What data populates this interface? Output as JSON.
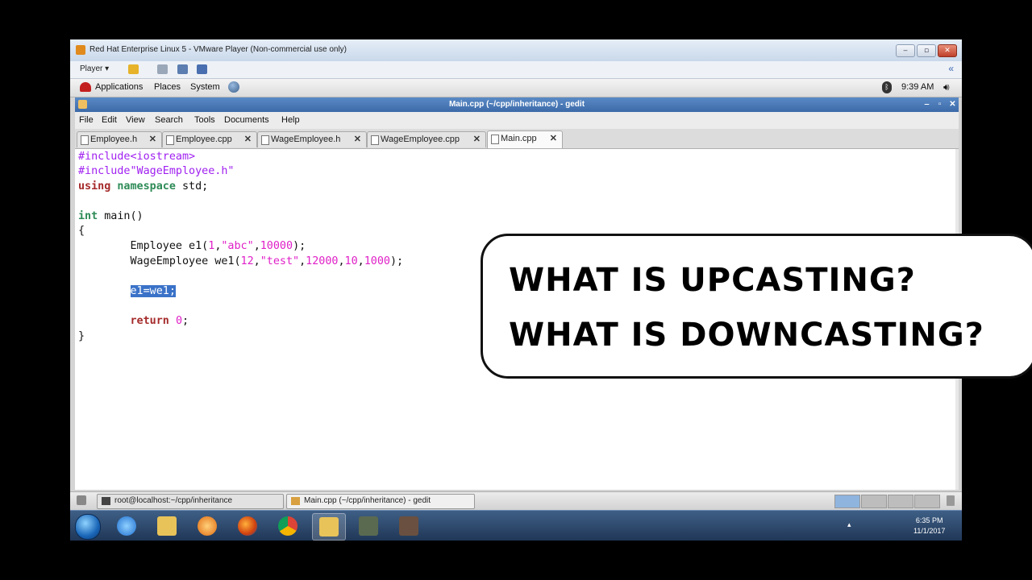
{
  "vmware": {
    "title": "Red Hat Enterprise Linux 5 - VMware Player (Non-commercial use only)",
    "player_menu": "Player ▾"
  },
  "gnome_panel": {
    "applications": "Applications",
    "places": "Places",
    "system": "System",
    "clock": "9:39 AM"
  },
  "gedit": {
    "title": "Main.cpp (~/cpp/inheritance) - gedit",
    "menu": [
      "File",
      "Edit",
      "View",
      "Search",
      "Tools",
      "Documents",
      "Help"
    ],
    "tabs": [
      "Employee.h",
      "Employee.cpp",
      "WageEmployee.h",
      "WageEmployee.cpp",
      "Main.cpp"
    ],
    "active_tab": "Main.cpp",
    "code": {
      "include1": "#include<iostream>",
      "include2": "#include\"WageEmployee.h\"",
      "using": "using",
      "namespace": "namespace",
      "std": " std;",
      "int": "int",
      "main": " main()",
      "open_brace": "{",
      "emp_decl": "        Employee e1(",
      "emp_a1": "1",
      "emp_a2": "\"abc\"",
      "emp_a3": "10000",
      "emp_end": ");",
      "wage_decl": "        WageEmployee we1(",
      "wage_a1": "12",
      "wage_a2": "\"test\"",
      "wage_a3": "12000",
      "wage_a4": "10",
      "wage_a5": "1000",
      "wage_end": ");",
      "assign": "e1=we1;",
      "indent": "        ",
      "return_kw": "return",
      "return_val": "0",
      "semicolon": ";",
      "comma": ",",
      "close_brace": "}"
    }
  },
  "callout": {
    "line1": "WHAT IS UPCASTING?",
    "line2": "WHAT IS DOWNCASTING?"
  },
  "gnome_taskbar": {
    "terminal": "root@localhost:~/cpp/inheritance",
    "gedit": "Main.cpp (~/cpp/inheritance) - gedit"
  },
  "windows_taskbar": {
    "time": "6:35 PM",
    "date": "11/1/2017",
    "tray": "▴"
  },
  "colors": {
    "preprocessor": "#a020f0",
    "keyword": "#a52a2a",
    "type": "#2e8b57",
    "literal": "#e020c8",
    "selection": "#3a72c8"
  }
}
